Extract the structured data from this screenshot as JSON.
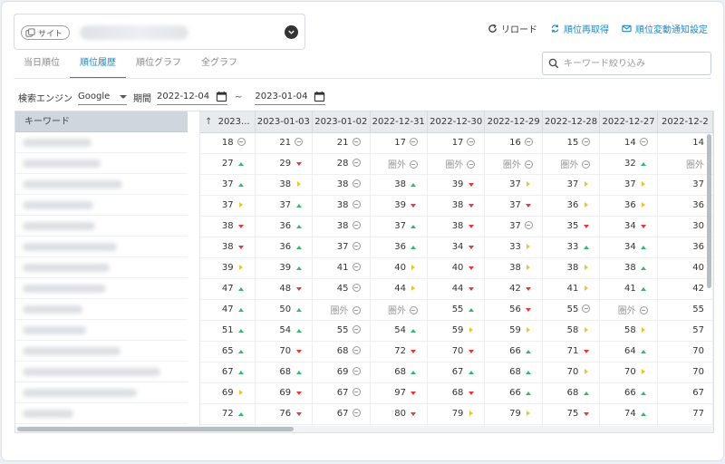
{
  "site": {
    "chip_label": "サイト"
  },
  "actions": {
    "reload": "リロード",
    "refetch": "順位再取得",
    "notify": "順位変動通知設定"
  },
  "tabs": [
    {
      "label": "当日順位",
      "active": false
    },
    {
      "label": "順位履歴",
      "active": true
    },
    {
      "label": "順位グラフ",
      "active": false
    },
    {
      "label": "全グラフ",
      "active": false
    }
  ],
  "search": {
    "placeholder": "キーワード絞り込み"
  },
  "filters": {
    "engine_label": "検索エンジン",
    "engine_value": "Google",
    "period_label": "期間",
    "date_from": "2022-12-04",
    "tilde": "~",
    "date_to": "2023-01-04"
  },
  "table": {
    "keyword_header": "キーワード",
    "columns": [
      "↑ 2023...",
      "2023-01-03",
      "2023-01-02",
      "2022-12-31",
      "2022-12-30",
      "2022-12-29",
      "2022-12-28",
      "2022-12-27",
      "2022-12-2"
    ],
    "keyword_blur_widths": [
      76,
      86,
      110,
      78,
      80,
      104,
      96,
      92,
      66,
      70,
      108,
      152,
      126,
      56,
      90
    ],
    "rows": [
      [
        [
          "18",
          "same"
        ],
        [
          "21",
          "same"
        ],
        [
          "21",
          "same"
        ],
        [
          "17",
          "same"
        ],
        [
          "17",
          "same"
        ],
        [
          "16",
          "same"
        ],
        [
          "15",
          "same"
        ],
        [
          "14",
          "same"
        ],
        [
          "14",
          ""
        ]
      ],
      [
        [
          "27",
          "up"
        ],
        [
          "29",
          "down"
        ],
        [
          "28",
          "same"
        ],
        [
          "圏外",
          "same"
        ],
        [
          "圏外",
          "same"
        ],
        [
          "圏外",
          "same"
        ],
        [
          "圏外",
          "same"
        ],
        [
          "32",
          "up"
        ],
        [
          "圏外",
          ""
        ]
      ],
      [
        [
          "37",
          "up"
        ],
        [
          "38",
          "right"
        ],
        [
          "38",
          "same"
        ],
        [
          "38",
          "up"
        ],
        [
          "39",
          "down"
        ],
        [
          "37",
          "right"
        ],
        [
          "37",
          "right"
        ],
        [
          "37",
          "right"
        ],
        [
          "37",
          ""
        ]
      ],
      [
        [
          "37",
          "right"
        ],
        [
          "37",
          "up"
        ],
        [
          "38",
          "same"
        ],
        [
          "39",
          "down"
        ],
        [
          "38",
          "down"
        ],
        [
          "37",
          "down"
        ],
        [
          "36",
          "right"
        ],
        [
          "36",
          "right"
        ],
        [
          "36",
          ""
        ]
      ],
      [
        [
          "38",
          "down"
        ],
        [
          "36",
          "up"
        ],
        [
          "38",
          "same"
        ],
        [
          "37",
          "up"
        ],
        [
          "38",
          "down"
        ],
        [
          "37",
          "same"
        ],
        [
          "35",
          "down"
        ],
        [
          "34",
          "down"
        ],
        [
          "30",
          ""
        ]
      ],
      [
        [
          "38",
          "down"
        ],
        [
          "36",
          "up"
        ],
        [
          "37",
          "same"
        ],
        [
          "36",
          "up"
        ],
        [
          "34",
          "down"
        ],
        [
          "33",
          "right"
        ],
        [
          "33",
          "up"
        ],
        [
          "34",
          "up"
        ],
        [
          "36",
          ""
        ]
      ],
      [
        [
          "39",
          "right"
        ],
        [
          "39",
          "up"
        ],
        [
          "41",
          "same"
        ],
        [
          "40",
          "right"
        ],
        [
          "40",
          "down"
        ],
        [
          "38",
          "right"
        ],
        [
          "38",
          "right"
        ],
        [
          "38",
          "up"
        ],
        [
          "40",
          ""
        ]
      ],
      [
        [
          "47",
          "up"
        ],
        [
          "48",
          "down"
        ],
        [
          "45",
          "same"
        ],
        [
          "44",
          "right"
        ],
        [
          "44",
          "down"
        ],
        [
          "42",
          "down"
        ],
        [
          "41",
          "right"
        ],
        [
          "41",
          "up"
        ],
        [
          "42",
          ""
        ]
      ],
      [
        [
          "47",
          "up"
        ],
        [
          "50",
          "up"
        ],
        [
          "圏外",
          "same"
        ],
        [
          "圏外",
          "same"
        ],
        [
          "55",
          "up"
        ],
        [
          "56",
          "down"
        ],
        [
          "55",
          "same"
        ],
        [
          "圏外",
          "same"
        ],
        [
          "55",
          ""
        ]
      ],
      [
        [
          "51",
          "up"
        ],
        [
          "54",
          "up"
        ],
        [
          "55",
          "same"
        ],
        [
          "54",
          "up"
        ],
        [
          "59",
          "right"
        ],
        [
          "59",
          "right"
        ],
        [
          "58",
          "right"
        ],
        [
          "58",
          "right"
        ],
        [
          "57",
          ""
        ]
      ],
      [
        [
          "65",
          "up"
        ],
        [
          "70",
          "down"
        ],
        [
          "68",
          "same"
        ],
        [
          "72",
          "down"
        ],
        [
          "70",
          "down"
        ],
        [
          "66",
          "up"
        ],
        [
          "71",
          "down"
        ],
        [
          "64",
          "up"
        ],
        [
          "70",
          ""
        ]
      ],
      [
        [
          "67",
          "up"
        ],
        [
          "68",
          "up"
        ],
        [
          "69",
          "same"
        ],
        [
          "68",
          "up"
        ],
        [
          "67",
          "up"
        ],
        [
          "68",
          "up"
        ],
        [
          "70",
          "right"
        ],
        [
          "70",
          "right"
        ],
        [
          "70",
          ""
        ]
      ],
      [
        [
          "69",
          "right"
        ],
        [
          "69",
          "down"
        ],
        [
          "67",
          "same"
        ],
        [
          "97",
          "down"
        ],
        [
          "68",
          "down"
        ],
        [
          "66",
          "up"
        ],
        [
          "68",
          "up"
        ],
        [
          "66",
          "up"
        ],
        [
          "67",
          ""
        ]
      ],
      [
        [
          "72",
          "up"
        ],
        [
          "76",
          "down"
        ],
        [
          "67",
          "same"
        ],
        [
          "80",
          "down"
        ],
        [
          "79",
          "right"
        ],
        [
          "79",
          "right"
        ],
        [
          "75",
          "down"
        ],
        [
          "74",
          "up"
        ],
        [
          "77",
          ""
        ]
      ],
      [
        [
          "",
          ""
        ],
        [
          "",
          ""
        ],
        [
          "",
          ""
        ],
        [
          "",
          ""
        ],
        [
          "",
          ""
        ],
        [
          "",
          ""
        ],
        [
          "",
          ""
        ],
        [
          "",
          ""
        ],
        [
          "",
          ""
        ]
      ]
    ]
  },
  "colors": {
    "accent": "#1e88c8",
    "up": "#3ab86a",
    "down": "#e53935",
    "flat": "#f2c230"
  }
}
